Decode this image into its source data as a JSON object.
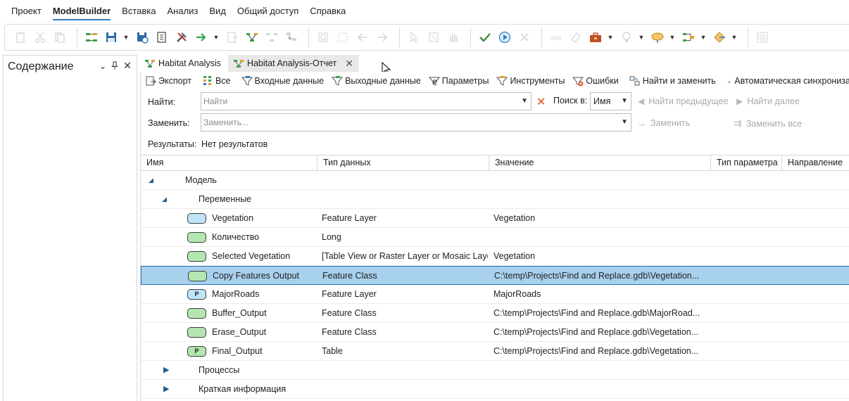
{
  "menu": {
    "items": [
      "Проект",
      "ModelBuilder",
      "Вставка",
      "Анализ",
      "Вид",
      "Общий доступ",
      "Справка"
    ]
  },
  "contents_pane": {
    "title": "Содержание"
  },
  "tabs": [
    {
      "label": "Habitat Analysis"
    },
    {
      "label": "Habitat Analysis-Отчет"
    }
  ],
  "report_toolbar": {
    "export": "Экспорт",
    "all": "Все",
    "inputs": "Входные данные",
    "outputs": "Выходные данные",
    "parameters": "Параметры",
    "tools": "Инструменты",
    "errors": "Ошибки",
    "find_replace": "Найти и заменить",
    "autosync": "Автоматическая синхронизация"
  },
  "find_form": {
    "find_label": "Найти:",
    "find_placeholder": "Найти",
    "search_in_label": "Поиск в:",
    "search_in_value": "Имя",
    "find_prev": "Найти предыдущее",
    "find_next": "Найти далее",
    "replace_label": "Заменить:",
    "replace_placeholder": "Заменить...",
    "replace_btn": "Заменить",
    "replace_all_btn": "Заменить все",
    "results_label": "Результаты:",
    "results_value": "Нет результатов"
  },
  "grid": {
    "columns": [
      "Имя",
      "Тип данных",
      "Значение",
      "Тип параметра",
      "Направление"
    ],
    "model_label": "Модель",
    "variables_label": "Переменные",
    "rows": [
      {
        "badge": "",
        "badge_color": "blue",
        "name": "Vegetation",
        "type": "Feature Layer",
        "value": "Vegetation"
      },
      {
        "badge": "",
        "badge_color": "green",
        "name": "Количество",
        "type": "Long",
        "value": ""
      },
      {
        "badge": "",
        "badge_color": "green",
        "name": "Selected Vegetation",
        "type": "[Table View or Raster Layer or Mosaic Layer]",
        "value": "Vegetation"
      },
      {
        "badge": "",
        "badge_color": "green",
        "name": "Copy Features Output",
        "type": "Feature Class",
        "value": "C:\\temp\\Projects\\Find and Replace.gdb\\Vegetation...",
        "selected": true
      },
      {
        "badge": "P",
        "badge_color": "blue",
        "name": "MajorRoads",
        "type": "Feature Layer",
        "value": "MajorRoads"
      },
      {
        "badge": "",
        "badge_color": "green",
        "name": "Buffer_Output",
        "type": "Feature Class",
        "value": "C:\\temp\\Projects\\Find and Replace.gdb\\MajorRoad..."
      },
      {
        "badge": "",
        "badge_color": "green",
        "name": "Erase_Output",
        "type": "Feature Class",
        "value": "C:\\temp\\Projects\\Find and Replace.gdb\\Vegetation..."
      },
      {
        "badge": "P",
        "badge_color": "green",
        "name": "Final_Output",
        "type": "Table",
        "value": "C:\\temp\\Projects\\Find and Replace.gdb\\Vegetation..."
      }
    ],
    "processes_label": "Процессы",
    "summary_label": "Краткая информация"
  },
  "colors": {
    "selection": "#a8d1ee",
    "accent": "#2f7fc1",
    "badge_blue": "#bfe3f7",
    "badge_green": "#b3e6b0"
  }
}
